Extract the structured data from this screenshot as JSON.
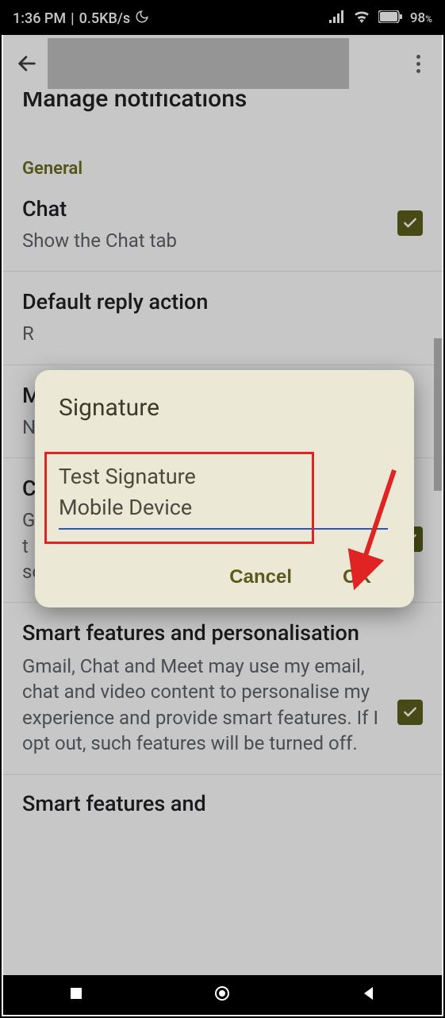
{
  "status": {
    "time": "1:36 PM",
    "sep": "|",
    "speed": "0.5KB/s",
    "battery": "98",
    "battery_unit": "%"
  },
  "sections": {
    "cut_top": "Manage notifications",
    "general": "General",
    "chat": {
      "title": "Chat",
      "sub": "Show the Chat tab"
    },
    "reply": {
      "title": "Default reply action",
      "sub": "R"
    },
    "m_row": {
      "title": "M",
      "sub": "N"
    },
    "c_row": {
      "title": "C",
      "sub_prefix": "G",
      "sub_line2": "t",
      "sub_line3": "some time to apply."
    },
    "smart": {
      "title": "Smart features and personalisation",
      "sub": "Gmail, Chat and Meet may use my email, chat and video content to personalise my experience and provide smart features. If I opt out, such features will be turned off."
    },
    "bottom_cut": "Smart features and"
  },
  "dialog": {
    "title": "Signature",
    "input_line1": "Test Signature",
    "input_line2": "Mobile Device",
    "cancel": "Cancel",
    "ok": "OK"
  }
}
